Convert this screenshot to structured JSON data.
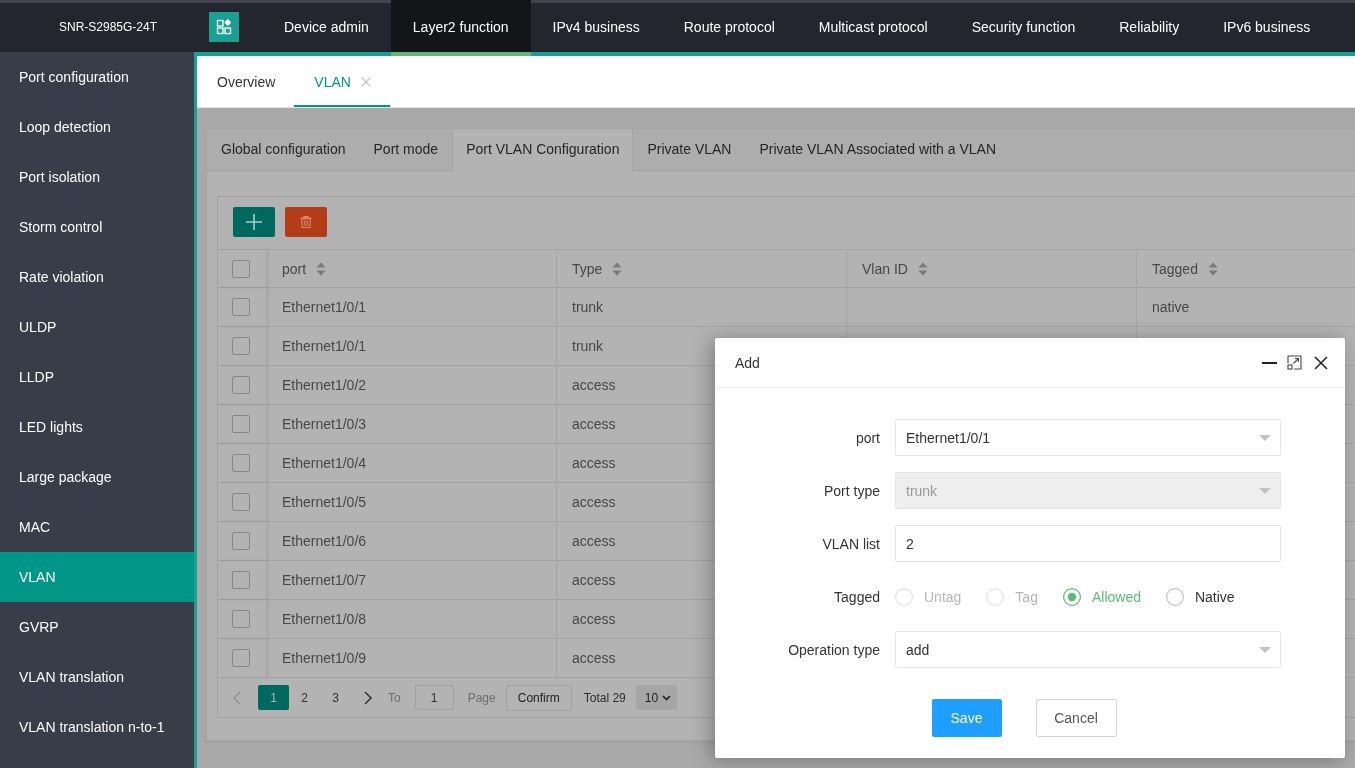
{
  "header": {
    "device_model": "SNR-S2985G-24T",
    "menu": [
      {
        "label": "Device admin",
        "selected": false
      },
      {
        "label": "Layer2 function",
        "selected": true
      },
      {
        "label": "IPv4 business",
        "selected": false
      },
      {
        "label": "Route protocol",
        "selected": false
      },
      {
        "label": "Multicast protocol",
        "selected": false
      },
      {
        "label": "Security function",
        "selected": false
      },
      {
        "label": "Reliability",
        "selected": false
      },
      {
        "label": "IPv6 business",
        "selected": false
      }
    ]
  },
  "sidebar": {
    "items": [
      {
        "label": "Port configuration",
        "selected": false
      },
      {
        "label": "Loop detection",
        "selected": false
      },
      {
        "label": "Port isolation",
        "selected": false
      },
      {
        "label": "Storm control",
        "selected": false
      },
      {
        "label": "Rate violation",
        "selected": false
      },
      {
        "label": "ULDP",
        "selected": false
      },
      {
        "label": "LLDP",
        "selected": false
      },
      {
        "label": "LED lights",
        "selected": false
      },
      {
        "label": "Large package",
        "selected": false
      },
      {
        "label": "MAC",
        "selected": false
      },
      {
        "label": "VLAN",
        "selected": true
      },
      {
        "label": "GVRP",
        "selected": false
      },
      {
        "label": "VLAN translation",
        "selected": false
      },
      {
        "label": "VLAN translation n-to-1",
        "selected": false
      }
    ]
  },
  "page_tabs": [
    {
      "label": "Overview",
      "selected": false,
      "closable": false
    },
    {
      "label": "VLAN",
      "selected": true,
      "closable": true
    }
  ],
  "config_tabs": [
    {
      "label": "Global configuration",
      "selected": false
    },
    {
      "label": "Port mode",
      "selected": false
    },
    {
      "label": "Port VLAN Configuration",
      "selected": true
    },
    {
      "label": "Private VLAN",
      "selected": false
    },
    {
      "label": "Private VLAN Associated with a VLAN",
      "selected": false
    }
  ],
  "table": {
    "select_all_checked": false,
    "columns": [
      {
        "label": "port",
        "sortable": true
      },
      {
        "label": "Type",
        "sortable": true
      },
      {
        "label": "Vlan ID",
        "sortable": true
      },
      {
        "label": "Tagged",
        "sortable": true
      }
    ],
    "rows": [
      {
        "checked": false,
        "port": "Ethernet1/0/1",
        "type": "trunk",
        "tagged": "native"
      },
      {
        "checked": false,
        "port": "Ethernet1/0/1",
        "type": "trunk"
      },
      {
        "checked": false,
        "port": "Ethernet1/0/2",
        "type": "access"
      },
      {
        "checked": false,
        "port": "Ethernet1/0/3",
        "type": "access"
      },
      {
        "checked": false,
        "port": "Ethernet1/0/4",
        "type": "access"
      },
      {
        "checked": false,
        "port": "Ethernet1/0/5",
        "type": "access"
      },
      {
        "checked": false,
        "port": "Ethernet1/0/6",
        "type": "access"
      },
      {
        "checked": false,
        "port": "Ethernet1/0/7",
        "type": "access"
      },
      {
        "checked": false,
        "port": "Ethernet1/0/8",
        "type": "access"
      },
      {
        "checked": false,
        "port": "Ethernet1/0/9",
        "type": "access"
      }
    ]
  },
  "pagination": {
    "previous_disabled": true,
    "next_disabled": false,
    "pages": [
      {
        "label": "1",
        "selected": true
      },
      {
        "label": "2",
        "selected": false
      },
      {
        "label": "3",
        "selected": false
      }
    ],
    "goto_label": "To",
    "goto_value": "1",
    "page_label": "Page",
    "confirm_label": "Confirm",
    "total": "Total 29",
    "page_size": "10"
  },
  "dialog": {
    "title": "Add",
    "fields": [
      {
        "kind": "select",
        "label": "port",
        "value": "Ethernet1/0/1",
        "disabled": false
      },
      {
        "kind": "select",
        "label": "Port type",
        "value": "trunk",
        "disabled": true
      },
      {
        "kind": "input",
        "label": "VLAN list",
        "value": "2"
      },
      {
        "kind": "radio",
        "label": "Tagged",
        "options": [
          {
            "label": "Untag",
            "selected": false,
            "disabled": true
          },
          {
            "label": "Tag",
            "selected": false,
            "disabled": true
          },
          {
            "label": "Allowed",
            "selected": true,
            "disabled": false
          },
          {
            "label": "Native",
            "selected": false,
            "disabled": false
          }
        ]
      },
      {
        "kind": "select",
        "label": "Operation type",
        "value": "add",
        "disabled": false
      }
    ],
    "buttons": [
      {
        "label": "Save",
        "kind": "primary"
      },
      {
        "label": "Cancel",
        "kind": "secondary"
      }
    ]
  }
}
